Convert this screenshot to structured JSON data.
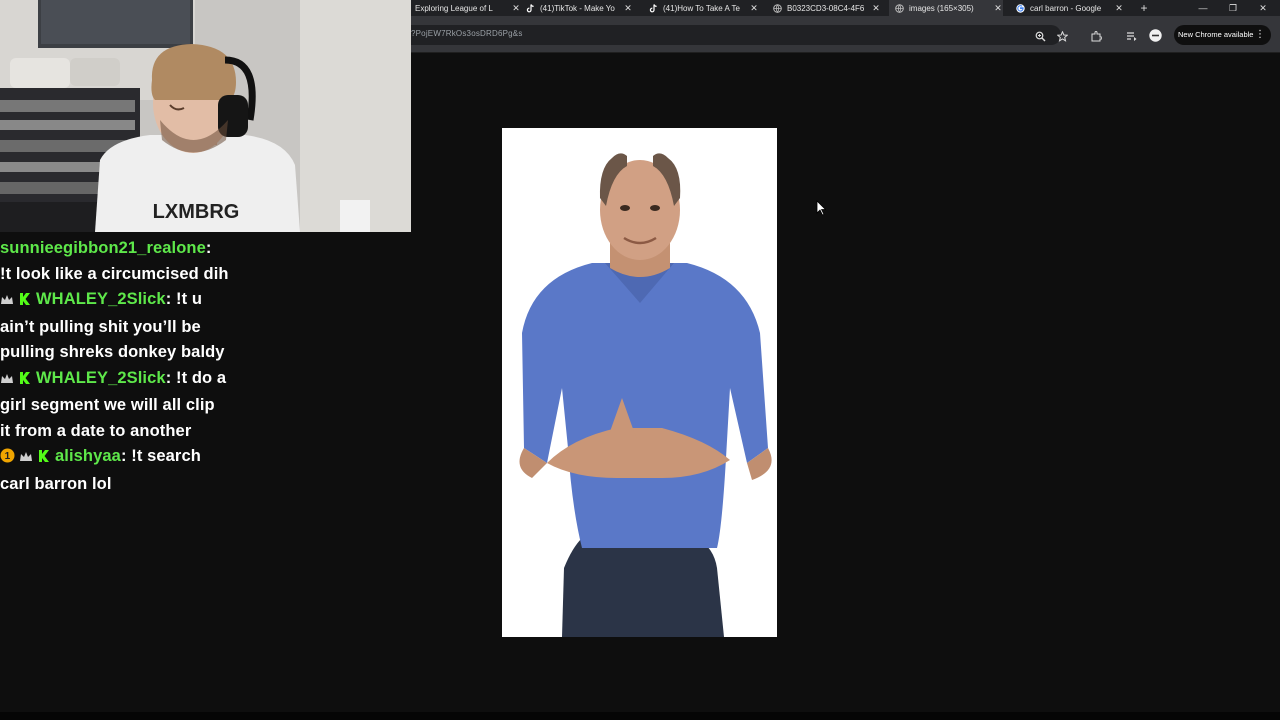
{
  "browser": {
    "tabs": [
      {
        "label": "Exploring League of L",
        "icon": "web-favicon",
        "active": false
      },
      {
        "label": "(41)TikTok - Make Yo",
        "icon": "tiktok-icon",
        "active": false
      },
      {
        "label": "(41)How To Take A Te",
        "icon": "tiktok-icon",
        "active": false
      },
      {
        "label": "B0323CD3-08C4-4F6",
        "icon": "globe-icon",
        "active": false
      },
      {
        "label": "images (165×305)",
        "icon": "globe-icon",
        "active": true
      },
      {
        "label": "carl barron - Google",
        "icon": "google-icon",
        "active": false
      }
    ],
    "new_tab_label": "+",
    "window_controls": {
      "minimize": "—",
      "restore": "❐",
      "close": "✕"
    },
    "url": "?PojEW7RkOs3osDRD6Pg&s",
    "update_button_label": "New Chrome available",
    "update_menu_label": "⋮"
  },
  "chat": {
    "messages": [
      {
        "user": "sunnieegibbon21_realone",
        "sep": ":",
        "text": "",
        "badges": []
      },
      {
        "user": "",
        "sep": "",
        "text": "!t look like a circumcised dih",
        "badges": []
      },
      {
        "user": "WHALEY_2Slick",
        "sep": ":",
        "text": " !t u",
        "badges": [
          "crown-icon",
          "k-badge-icon"
        ]
      },
      {
        "user": "",
        "sep": "",
        "text": "ain’t pulling shit you’ll be",
        "badges": []
      },
      {
        "user": "",
        "sep": "",
        "text": "pulling shreks donkey baldy",
        "badges": []
      },
      {
        "user": "WHALEY_2Slick",
        "sep": ":",
        "text": " !t do a",
        "badges": [
          "crown-icon",
          "k-badge-icon"
        ]
      },
      {
        "user": "",
        "sep": "",
        "text": "girl segment we will all clip",
        "badges": []
      },
      {
        "user": "",
        "sep": "",
        "text": "it from a date to another",
        "badges": []
      },
      {
        "user": "alishyaa",
        "sep": ":",
        "text": " !t search",
        "badges": [
          "sub-badge-icon",
          "crown-icon",
          "k-badge-icon"
        ]
      },
      {
        "user": "",
        "sep": "",
        "text": "carl barron lol",
        "badges": []
      }
    ]
  },
  "webcam": {
    "shirt_text": "LXMBRG"
  },
  "colors": {
    "username": "#5ee84a",
    "chat_text": "#ffffff",
    "background": "#0e0e0e",
    "shirt_person": "#5a78c8"
  }
}
